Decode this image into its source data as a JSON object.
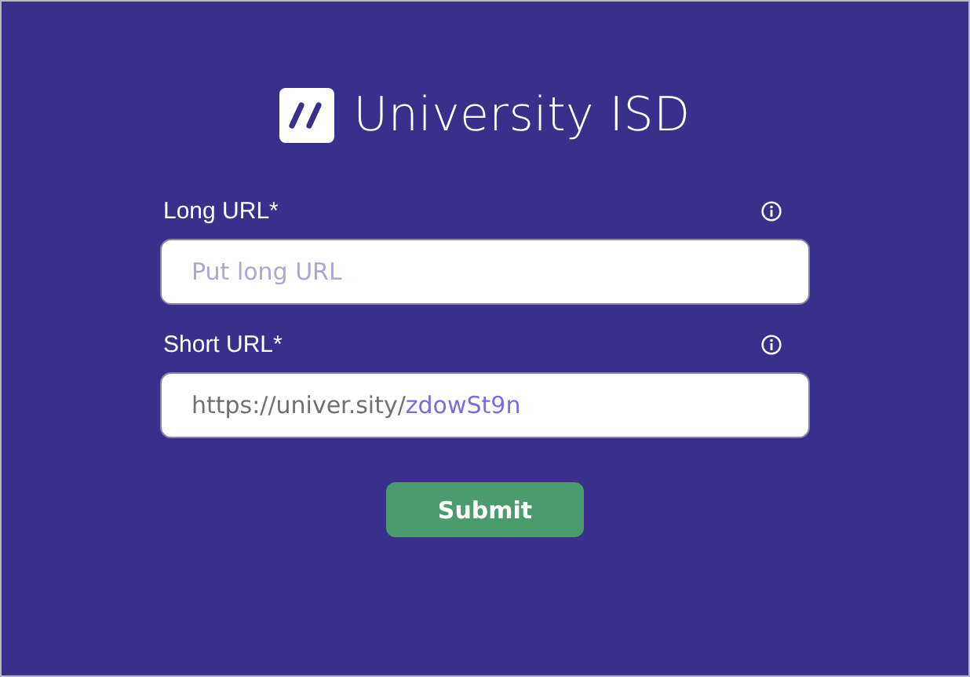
{
  "brand": {
    "name": "University ISD"
  },
  "fields": [
    {
      "label": "Long URL*",
      "placeholder": "Put long URL",
      "kind": "input"
    },
    {
      "label": "Short URL*",
      "prefix": "https://univer.sity/",
      "value": "zdowSt9n",
      "kind": "generated"
    }
  ],
  "submit": {
    "label": "Submit"
  }
}
